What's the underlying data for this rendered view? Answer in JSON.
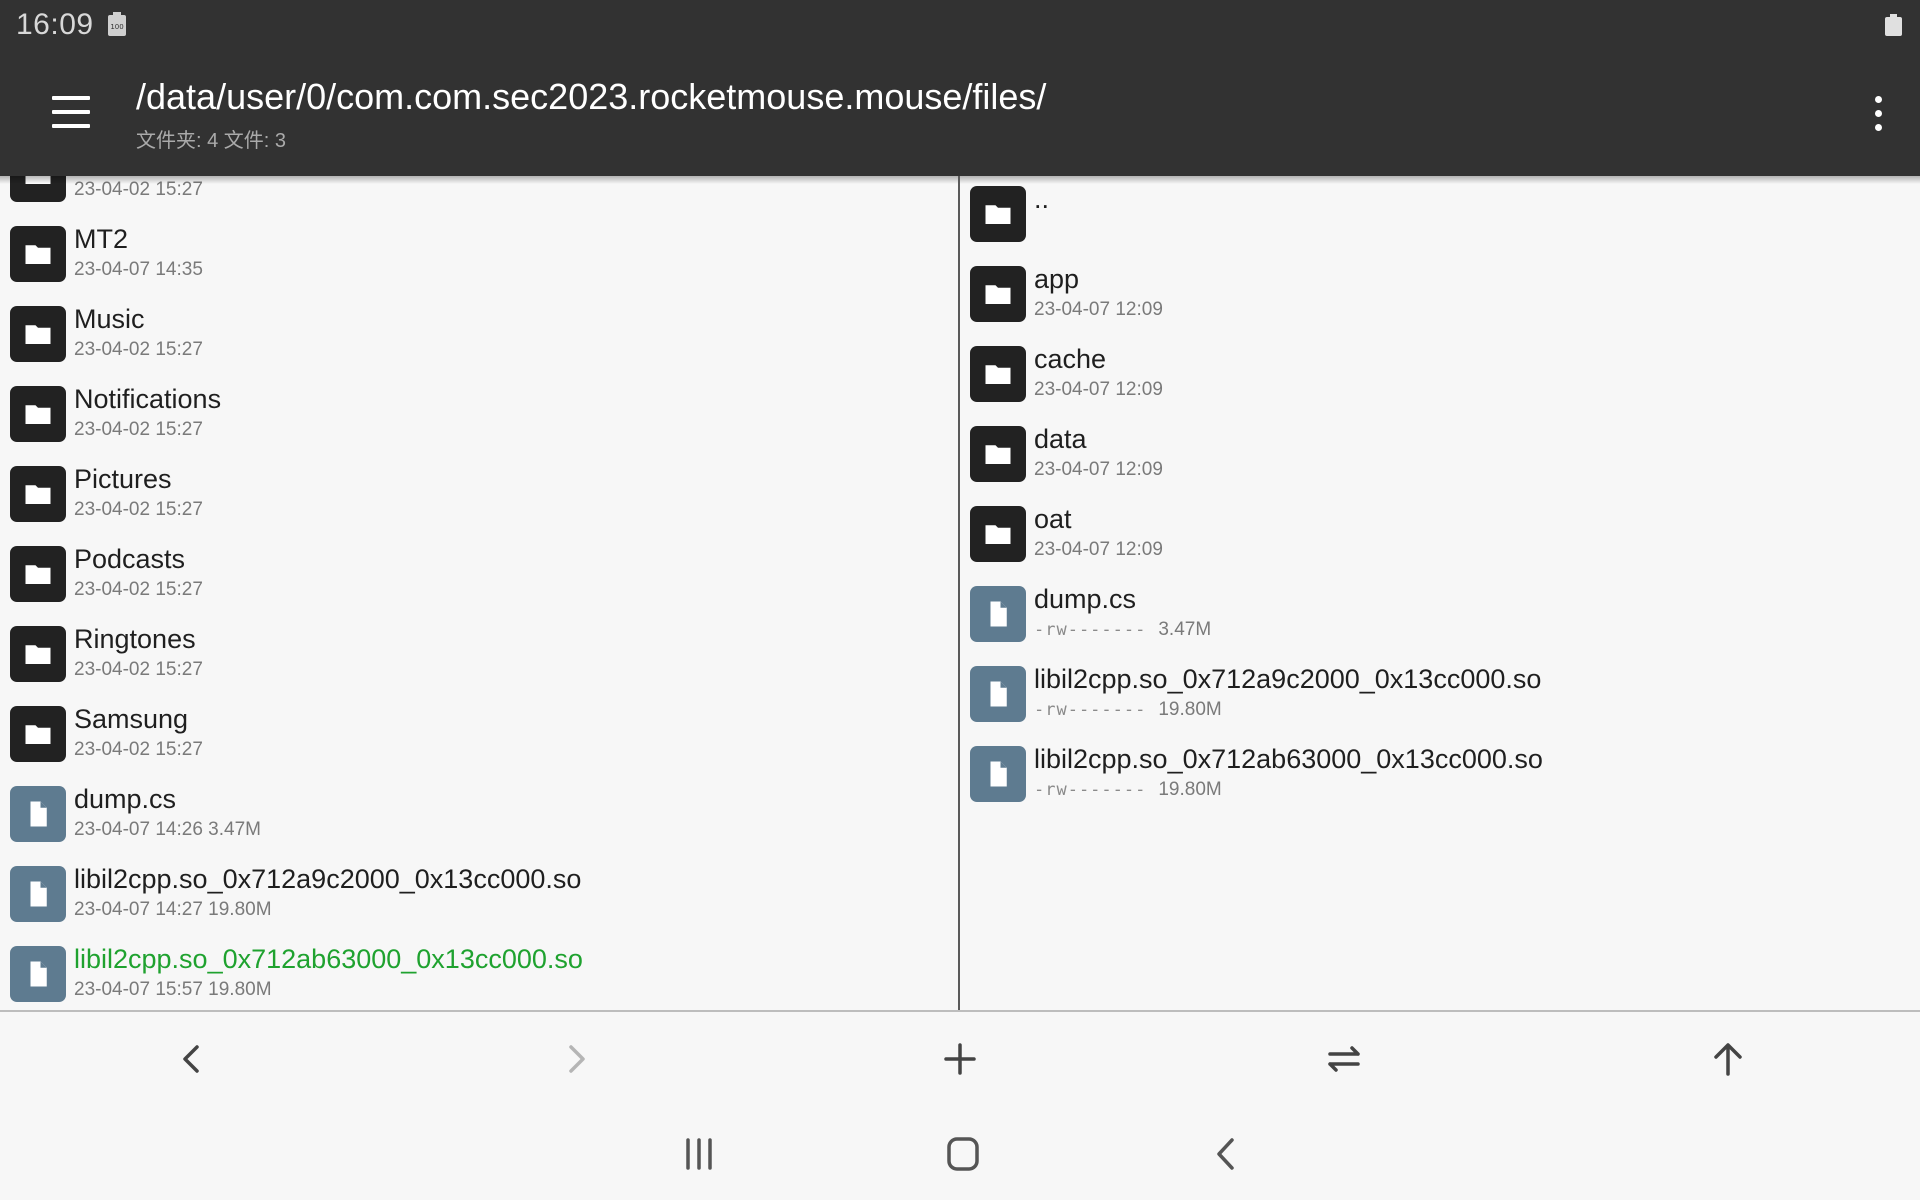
{
  "status_bar": {
    "time": "16:09",
    "battery_small_label": "100"
  },
  "toolbar": {
    "path": "/data/user/0/com.com.sec2023.rocketmouse.mouse/files/",
    "summary": "文件夹: 4  文件: 3"
  },
  "left_pane": {
    "partial_row": {
      "meta": "23-04-02 15:27"
    },
    "items": [
      {
        "name": "MT2",
        "meta": "23-04-07 14:35",
        "type": "folder"
      },
      {
        "name": "Music",
        "meta": "23-04-02 15:27",
        "type": "folder"
      },
      {
        "name": "Notifications",
        "meta": "23-04-02 15:27",
        "type": "folder"
      },
      {
        "name": "Pictures",
        "meta": "23-04-02 15:27",
        "type": "folder"
      },
      {
        "name": "Podcasts",
        "meta": "23-04-02 15:27",
        "type": "folder"
      },
      {
        "name": "Ringtones",
        "meta": "23-04-02 15:27",
        "type": "folder"
      },
      {
        "name": "Samsung",
        "meta": "23-04-02 15:27",
        "type": "folder"
      },
      {
        "name": "dump.cs",
        "meta": "23-04-07 14:26  3.47M",
        "type": "file"
      },
      {
        "name": "libil2cpp.so_0x712a9c2000_0x13cc000.so",
        "meta": "23-04-07 14:27  19.80M",
        "type": "file"
      },
      {
        "name": "libil2cpp.so_0x712ab63000_0x13cc000.so",
        "meta": "23-04-07 15:57  19.80M",
        "type": "file",
        "highlight": true
      }
    ]
  },
  "right_pane": {
    "parent": {
      "name": ".."
    },
    "items": [
      {
        "name": "app",
        "meta": "23-04-07 12:09",
        "type": "folder"
      },
      {
        "name": "cache",
        "meta": "23-04-07 12:09",
        "type": "folder"
      },
      {
        "name": "data",
        "meta": "23-04-07 12:09",
        "type": "folder"
      },
      {
        "name": "oat",
        "meta": "23-04-07 12:09",
        "type": "folder"
      },
      {
        "name": "dump.cs",
        "perm": "-rw-------",
        "size": "3.47M",
        "type": "file"
      },
      {
        "name": "libil2cpp.so_0x712a9c2000_0x13cc000.so",
        "perm": "-rw-------",
        "size": "19.80M",
        "type": "file"
      },
      {
        "name": "libil2cpp.so_0x712ab63000_0x13cc000.so",
        "perm": "-rw-------",
        "size": "19.80M",
        "type": "file"
      }
    ]
  },
  "bottom_bar": {
    "icons": [
      "chevron-left-icon",
      "chevron-right-icon",
      "plus-icon",
      "swap-icon",
      "arrow-up-icon"
    ]
  },
  "nav_bar": {
    "icons": [
      "recents-icon",
      "home-icon",
      "back-icon"
    ]
  },
  "colors": {
    "toolbar": "#323232",
    "highlight_text": "#1fa22f",
    "file_icon": "#5e7b90",
    "folder_icon": "#222222"
  }
}
